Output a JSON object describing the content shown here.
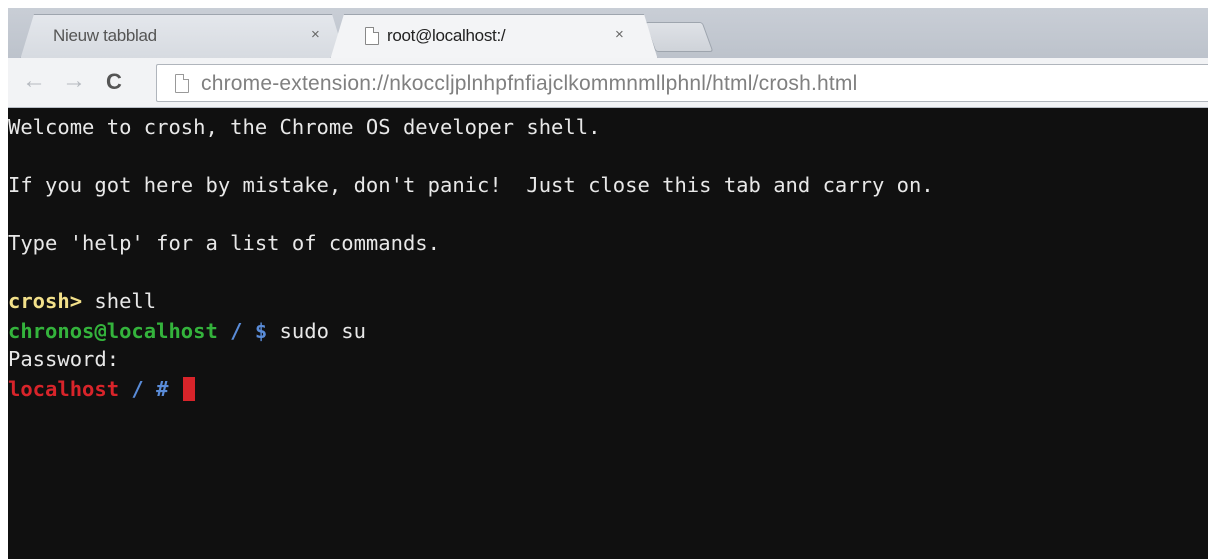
{
  "browser": {
    "tabs": [
      {
        "title": "Nieuw tabblad",
        "close": "×",
        "active": false
      },
      {
        "title": "root@localhost:/",
        "close": "×",
        "active": true
      }
    ],
    "nav": {
      "back_icon": "arrow-left-icon",
      "forward_icon": "arrow-right-icon",
      "reload_icon": "reload-icon",
      "back_glyph": "←",
      "forward_glyph": "→",
      "reload_glyph": "C"
    },
    "url": "chrome-extension://nkoccljplnhpfnfiajclkommnmllphnl/html/crosh.html"
  },
  "terminal": {
    "welcome": "Welcome to crosh, the Chrome OS developer shell.",
    "mistake": "If you got here by mistake, don't panic!  Just close this tab and carry on.",
    "help": "Type 'help' for a list of commands.",
    "crosh_prompt": "crosh>",
    "crosh_command": " shell",
    "chronos_prompt_user": "chronos@localhost",
    "chronos_prompt_path": " / $",
    "chronos_command": " sudo su",
    "password_label": "Password:",
    "root_prompt_host": "localhost",
    "root_prompt_path": " / #",
    "colors": {
      "background": "#101010",
      "text": "#e8e8e8",
      "crosh_prompt": "#f2e08a",
      "user_prompt": "#34b33c",
      "path": "#5a8cd8",
      "root_prompt": "#d8242a",
      "cursor": "#d8242a"
    }
  }
}
